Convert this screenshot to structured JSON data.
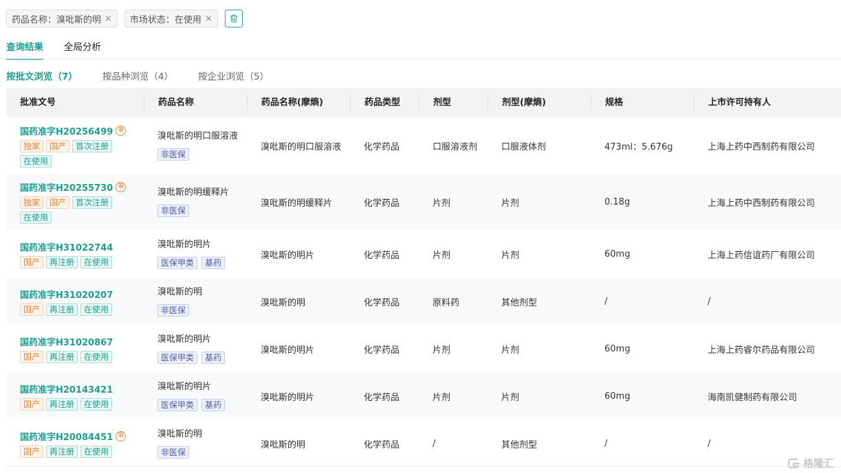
{
  "filters": [
    {
      "label": "药品名称：溴吡斯的明",
      "close": "×"
    },
    {
      "label": "市场状态：在使用",
      "close": "×"
    }
  ],
  "tabs": [
    {
      "label": "查询结果",
      "active": true
    },
    {
      "label": "全局分析",
      "active": false
    }
  ],
  "subtabs": [
    {
      "label": "按批文浏览（7）",
      "active": true
    },
    {
      "label": "按品种浏览（4）",
      "active": false
    },
    {
      "label": "按企业浏览（5）",
      "active": false
    }
  ],
  "table": {
    "headers": [
      "批准文号",
      "药品名称",
      "药品名称(摩熵)",
      "药品类型",
      "剂型",
      "剂型(摩熵)",
      "规格",
      "上市许可持有人"
    ],
    "rows": [
      {
        "approval": "国药准字H20256499",
        "audit": true,
        "audit_glyph": "审",
        "tags": [
          "独家",
          "国产",
          "首次注册",
          "在使用"
        ],
        "name": "溴吡斯的明口服溶液",
        "insurance": [
          "非医保"
        ],
        "name_ms": "溴吡斯的明口服溶液",
        "type": "化学药品",
        "form": "口服溶液剂",
        "form_ms": "口服液体剂",
        "spec": "473ml：5.676g",
        "holder": "上海上药中西制药有限公司"
      },
      {
        "approval": "国药准字H20255730",
        "audit": true,
        "audit_glyph": "审",
        "tags": [
          "独家",
          "国产",
          "首次注册",
          "在使用"
        ],
        "name": "溴吡斯的明缓释片",
        "insurance": [
          "非医保"
        ],
        "name_ms": "溴吡斯的明缓释片",
        "type": "化学药品",
        "form": "片剂",
        "form_ms": "片剂",
        "spec": "0.18g",
        "holder": "上海上药中西制药有限公司"
      },
      {
        "approval": "国药准字H31022744",
        "audit": false,
        "audit_glyph": "",
        "tags": [
          "国产",
          "再注册",
          "在使用"
        ],
        "name": "溴吡斯的明片",
        "insurance": [
          "医保甲类",
          "基药"
        ],
        "name_ms": "溴吡斯的明片",
        "type": "化学药品",
        "form": "片剂",
        "form_ms": "片剂",
        "spec": "60mg",
        "holder": "上海上药信谊药厂有限公司"
      },
      {
        "approval": "国药准字H31020207",
        "audit": false,
        "audit_glyph": "",
        "tags": [
          "国产",
          "再注册",
          "在使用"
        ],
        "name": "溴吡斯的明",
        "insurance": [
          "非医保"
        ],
        "name_ms": "溴吡斯的明",
        "type": "化学药品",
        "form": "原料药",
        "form_ms": "其他剂型",
        "spec": "/",
        "holder": "/"
      },
      {
        "approval": "国药准字H31020867",
        "audit": false,
        "audit_glyph": "",
        "tags": [
          "国产",
          "再注册",
          "在使用"
        ],
        "name": "溴吡斯的明片",
        "insurance": [
          "医保甲类",
          "基药"
        ],
        "name_ms": "溴吡斯的明片",
        "type": "化学药品",
        "form": "片剂",
        "form_ms": "片剂",
        "spec": "60mg",
        "holder": "上海上药睿尔药品有限公司"
      },
      {
        "approval": "国药准字H20143421",
        "audit": false,
        "audit_glyph": "",
        "tags": [
          "国产",
          "再注册",
          "在使用"
        ],
        "name": "溴吡斯的明片",
        "insurance": [
          "医保甲类",
          "基药"
        ],
        "name_ms": "溴吡斯的明片",
        "type": "化学药品",
        "form": "片剂",
        "form_ms": "片剂",
        "spec": "60mg",
        "holder": "海南凯健制药有限公司"
      },
      {
        "approval": "国药准字H20084451",
        "audit": true,
        "audit_glyph": "审",
        "tags": [
          "国产",
          "再注册",
          "在使用"
        ],
        "name": "溴吡斯的明",
        "insurance": [
          "非医保"
        ],
        "name_ms": "溴吡斯的明",
        "type": "化学药品",
        "form": "/",
        "form_ms": "其他剂型",
        "spec": "/",
        "holder": "/"
      }
    ]
  },
  "watermark": {
    "text": "格隆汇",
    "icon": "gelonghui-logo-icon"
  },
  "colors": {
    "accent": "#1f9d90",
    "orange_tag": "#e8823a",
    "blue_tag": "#4a5ba8"
  }
}
